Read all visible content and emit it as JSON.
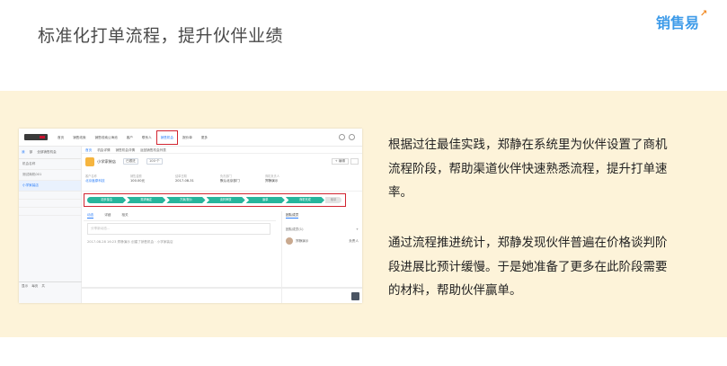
{
  "slide": {
    "title": "标准化打单流程，提升伙伴业绩",
    "logo_text": "销售易",
    "logo_mark": "↗",
    "paragraphs": [
      "根据过往最佳实践，郑静在系统里为伙伴设置了商机流程阶段，帮助渠道伙伴快速熟悉流程，提升打单速率。",
      "通过流程推进统计，郑静发现伙伴普遍在价格谈判阶段进展比预计缓慢。于是她准备了更多在此阶段需要的材料，帮助伙伴赢单。"
    ]
  },
  "crm": {
    "nav": [
      "首页",
      "销售线索",
      "销售线索公海池",
      "客户",
      "联系人",
      "销售机会",
      "报价单",
      "更多"
    ],
    "active_nav_index": 5,
    "sidebar": {
      "tabs": [
        "我",
        "部",
        "全部销售机会"
      ],
      "items": [
        "机会名称",
        "测试商机001",
        "小学家装店"
      ],
      "footer": [
        "显示",
        "每页",
        "共"
      ]
    },
    "breadcrumb": [
      "首页",
      "机会详情",
      "销售机会详情",
      "返回销售机会列表"
    ],
    "opportunity": {
      "name": "小学家装店",
      "pill_1": "已跟进",
      "pill_2": "100·个",
      "edit_button": "+ 编辑"
    },
    "fields": [
      {
        "label": "客户名称",
        "value": "北京鑫原科技"
      },
      {
        "label": "销售金额",
        "value": "100.00元"
      },
      {
        "label": "结单日期",
        "value": "2017-08-31"
      },
      {
        "label": "负责部门",
        "value": "默认北京部门"
      },
      {
        "label": "商机负责人",
        "value": "郑静演示"
      }
    ],
    "stages": [
      "初步接洽",
      "需求确定",
      "方案/报价",
      "谈判审核",
      "赢单",
      "商机完成",
      "输单"
    ],
    "tabs": [
      "动态",
      "详细",
      "相关"
    ],
    "compose_placeholder": "分享新动态...",
    "feed_entry": "2017-08-28 16:23 郑静演示 创建了销售机会 · 小学家装店",
    "right_panel": {
      "tab": "团队成员",
      "line_left": "团队成员(1)",
      "line_right": "+",
      "contact_name": "郑静演示",
      "contact_role": "负责人"
    }
  }
}
